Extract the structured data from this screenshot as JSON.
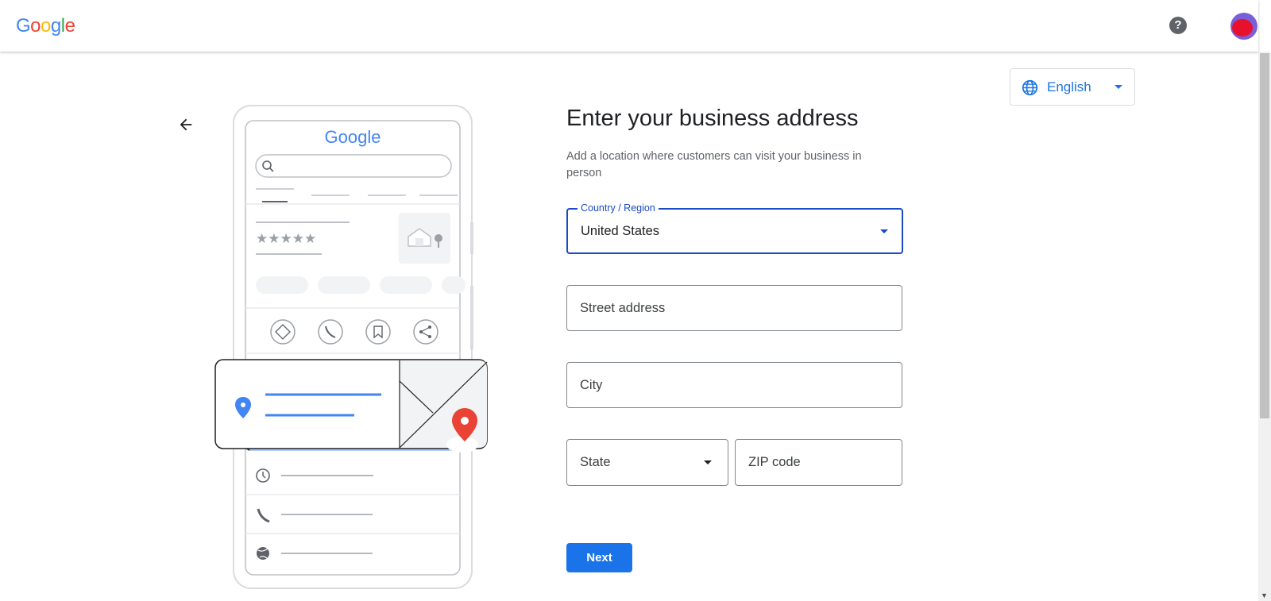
{
  "header": {
    "logo_letters": [
      {
        "ch": "G",
        "color": "#4285F4"
      },
      {
        "ch": "o",
        "color": "#EA4335"
      },
      {
        "ch": "o",
        "color": "#FBBC05"
      },
      {
        "ch": "g",
        "color": "#4285F4"
      },
      {
        "ch": "l",
        "color": "#34A853"
      },
      {
        "ch": "e",
        "color": "#EA4335"
      }
    ],
    "help_glyph": "?"
  },
  "language": {
    "label": "English",
    "icon": "globe-icon"
  },
  "illustration": {
    "logo_text": "Google"
  },
  "form": {
    "title": "Enter your business address",
    "subtitle": "Add a location where customers can visit your business in person",
    "country": {
      "label": "Country / Region",
      "value": "United States"
    },
    "street": {
      "placeholder": "Street address"
    },
    "city": {
      "placeholder": "City"
    },
    "state": {
      "placeholder": "State"
    },
    "zip": {
      "placeholder": "ZIP code"
    },
    "next_label": "Next"
  },
  "colors": {
    "accent": "#1a73e8",
    "focus": "#1a4bc5",
    "pin_red": "#EA4335"
  }
}
